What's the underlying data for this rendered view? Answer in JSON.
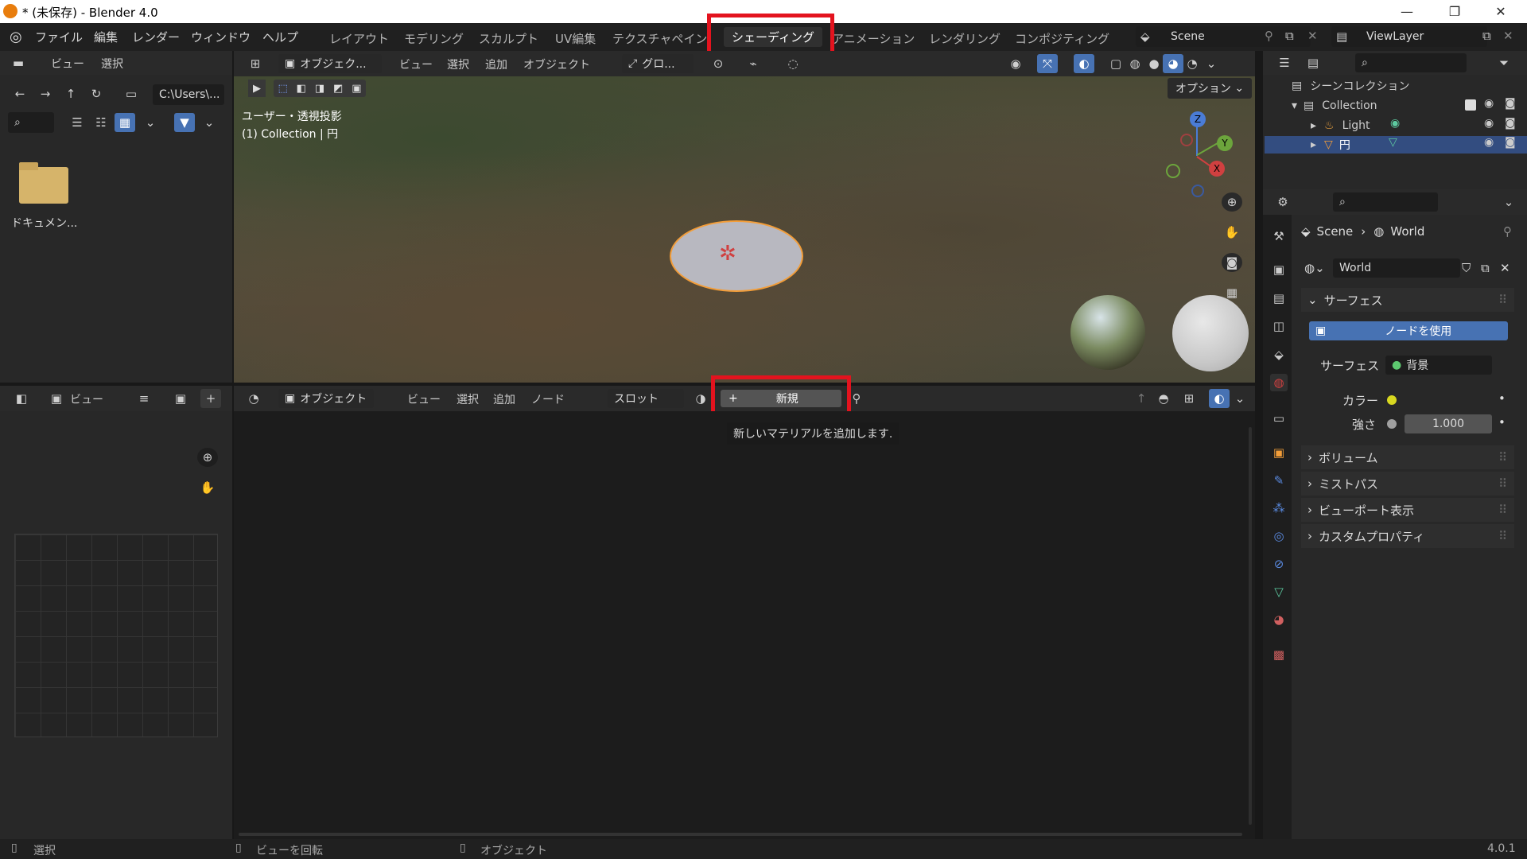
{
  "window": {
    "title": "* (未保存) - Blender 4.0",
    "minimize": "—",
    "maximize": "❐",
    "close": "✕"
  },
  "menu": {
    "items": [
      "ファイル",
      "編集",
      "レンダー",
      "ウィンドウ",
      "ヘルプ"
    ]
  },
  "workspaces": [
    "レイアウト",
    "モデリング",
    "スカルプト",
    "UV編集",
    "テクスチャペイント",
    "シェーディング",
    "アニメーション",
    "レンダリング",
    "コンポジティング"
  ],
  "active_workspace": "シェーディング",
  "scene": {
    "name": "Scene",
    "view_layer": "ViewLayer"
  },
  "file_browser": {
    "menu_view": "ビュー",
    "menu_select": "選択",
    "path": "C:\\Users\\...",
    "folder_label": "ドキュメン..."
  },
  "viewport": {
    "mode": "オブジェク...",
    "menus": [
      "ビュー",
      "選択",
      "追加",
      "オブジェクト"
    ],
    "transform": "グロ...",
    "options": "オプション",
    "overlay_line1": "ユーザー・透視投影",
    "overlay_line2": "(1) Collection | 円",
    "axis_x": "X",
    "axis_y": "Y",
    "axis_z": "Z"
  },
  "outliner": {
    "root": "シーンコレクション",
    "collection": "Collection",
    "items": [
      {
        "name": "Light"
      },
      {
        "name": "円"
      }
    ]
  },
  "properties": {
    "breadcrumb_scene": "Scene",
    "breadcrumb_world": "World",
    "world_name": "World",
    "surface_panel": "サーフェス",
    "use_nodes": "ノードを使用",
    "surface_label": "サーフェス",
    "surface_value": "背景",
    "color_label": "カラー",
    "strength_label": "強さ",
    "strength_value": "1.000",
    "color_swatch": "#d8d820",
    "subpanels": [
      "ボリューム",
      "ミストパス",
      "ビューポート表示",
      "カスタムプロパティ"
    ]
  },
  "image_editor": {
    "view": "ビュー"
  },
  "node_editor": {
    "mode": "オブジェクト",
    "menus": [
      "ビュー",
      "選択",
      "追加",
      "ノード"
    ],
    "slot": "スロット",
    "new_button": "新規",
    "tooltip": "新しいマテリアルを追加します."
  },
  "status_bar": {
    "select": "選択",
    "rotate": "ビューを回転",
    "object": "オブジェクト",
    "version": "4.0.1"
  },
  "colors": {
    "accent_blue": "#4772b3",
    "highlight_red": "#e3131e",
    "selected_orange": "#f29d39"
  }
}
